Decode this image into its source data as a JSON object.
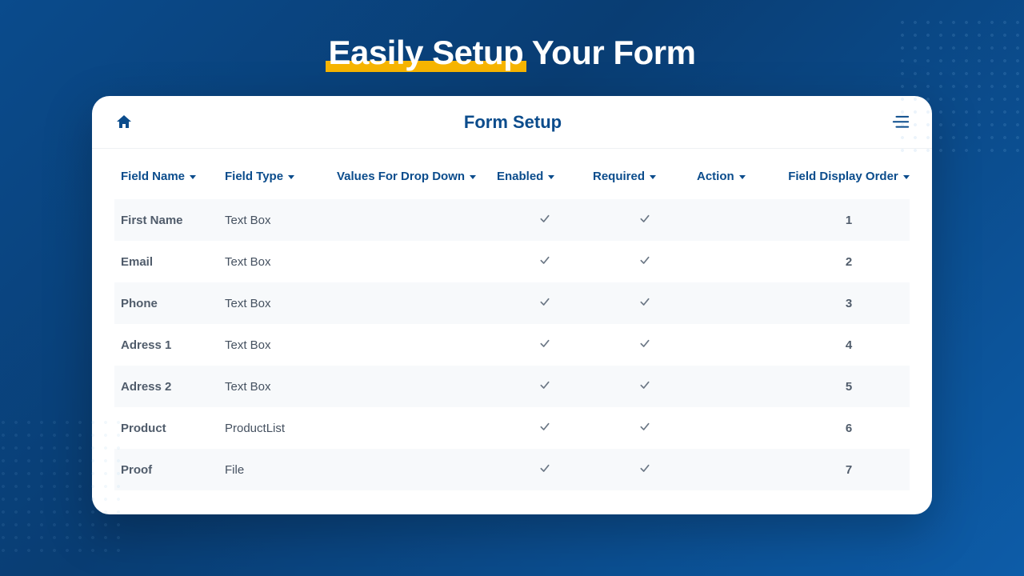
{
  "banner": {
    "highlight": "Easily Setup",
    "rest": " Your Form"
  },
  "card": {
    "title": "Form Setup"
  },
  "columns": {
    "fieldName": "Field Name",
    "fieldType": "Field Type",
    "valuesForDropDown": "Values For Drop Down",
    "enabled": "Enabled",
    "required": "Required",
    "action": "Action",
    "displayOrder": "Field Display Order"
  },
  "rows": [
    {
      "name": "First Name",
      "type": "Text Box",
      "values": "",
      "enabled": true,
      "required": true,
      "action": "",
      "order": "1"
    },
    {
      "name": "Email",
      "type": "Text Box",
      "values": "",
      "enabled": true,
      "required": true,
      "action": "",
      "order": "2"
    },
    {
      "name": "Phone",
      "type": "Text Box",
      "values": "",
      "enabled": true,
      "required": true,
      "action": "",
      "order": "3"
    },
    {
      "name": "Adress 1",
      "type": "Text Box",
      "values": "",
      "enabled": true,
      "required": true,
      "action": "",
      "order": "4"
    },
    {
      "name": "Adress 2",
      "type": "Text Box",
      "values": "",
      "enabled": true,
      "required": true,
      "action": "",
      "order": "5"
    },
    {
      "name": "Product",
      "type": "ProductList",
      "values": "",
      "enabled": true,
      "required": true,
      "action": "",
      "order": "6"
    },
    {
      "name": "Proof",
      "type": "File",
      "values": "",
      "enabled": true,
      "required": true,
      "action": "",
      "order": "7"
    }
  ],
  "icons": {
    "home": "home-icon",
    "menu": "hamburger-icon",
    "check": "checkmark-icon",
    "caret": "caret-down-icon"
  }
}
